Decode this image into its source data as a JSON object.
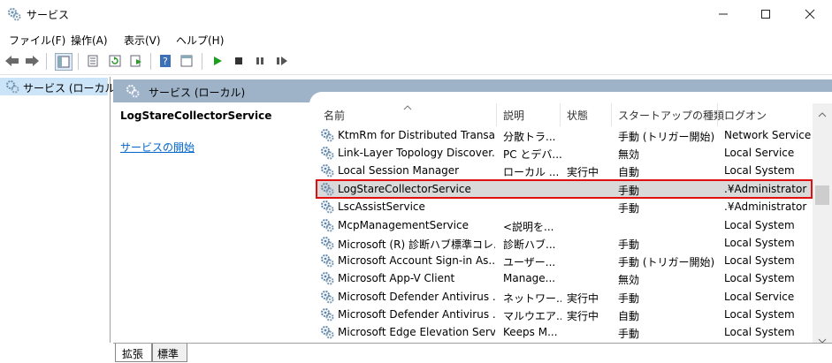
{
  "window": {
    "title": "サービス"
  },
  "menu": [
    "ファイル(F)",
    "操作(A)",
    "表示(V)",
    "ヘルプ(H)"
  ],
  "tree": {
    "selected_label": "サービス (ローカル)"
  },
  "panel": {
    "title": "サービス (ローカル)"
  },
  "detail": {
    "service_name": "LogStareCollectorService",
    "start_link": "サービスの開始"
  },
  "columns": [
    "名前",
    "説明",
    "状態",
    "スタートアップの種類",
    "ログオン"
  ],
  "rows": [
    {
      "name": "KtmRm for Distributed Transa...",
      "desc": "分散トラ...",
      "status": "",
      "startup": "手動 (トリガー開始)",
      "logon": "Network Service"
    },
    {
      "name": "Link-Layer Topology Discover...",
      "desc": "PC とデバ...",
      "status": "",
      "startup": "無効",
      "logon": "Local Service"
    },
    {
      "name": "Local Session Manager",
      "desc": "ローカル ...",
      "status": "実行中",
      "startup": "自動",
      "logon": "Local System"
    },
    {
      "name": "LogStareCollectorService",
      "desc": "",
      "status": "",
      "startup": "手動",
      "logon": ".¥Administrator"
    },
    {
      "name": "LscAssistService",
      "desc": "",
      "status": "",
      "startup": "手動",
      "logon": ".¥Administrator"
    },
    {
      "name": "McpManagementService",
      "desc": "<説明を...",
      "status": "",
      "startup": "",
      "logon": "Local System"
    },
    {
      "name": "Microsoft (R) 診断ハブ標準コレ...",
      "desc": "診断ハブ...",
      "status": "",
      "startup": "手動",
      "logon": "Local System"
    },
    {
      "name": "Microsoft Account Sign-in As...",
      "desc": "ユーザー...",
      "status": "",
      "startup": "手動 (トリガー開始)",
      "logon": "Local System"
    },
    {
      "name": "Microsoft App-V Client",
      "desc": "Manage...",
      "status": "",
      "startup": "無効",
      "logon": "Local System"
    },
    {
      "name": "Microsoft Defender Antivirus ...",
      "desc": "ネットワー...",
      "status": "実行中",
      "startup": "手動",
      "logon": "Local Service"
    },
    {
      "name": "Microsoft Defender Antivirus ...",
      "desc": "マルウエア...",
      "status": "実行中",
      "startup": "自動",
      "logon": "Local System"
    },
    {
      "name": "Microsoft Edge Elevation Serv...",
      "desc": "Keeps M...",
      "status": "",
      "startup": "手動",
      "logon": "Local System"
    }
  ],
  "tabs": [
    "拡張",
    "標準"
  ],
  "colors": {
    "band": "#9eb3c8",
    "highlight": "#e01010",
    "link": "#0066cc"
  }
}
